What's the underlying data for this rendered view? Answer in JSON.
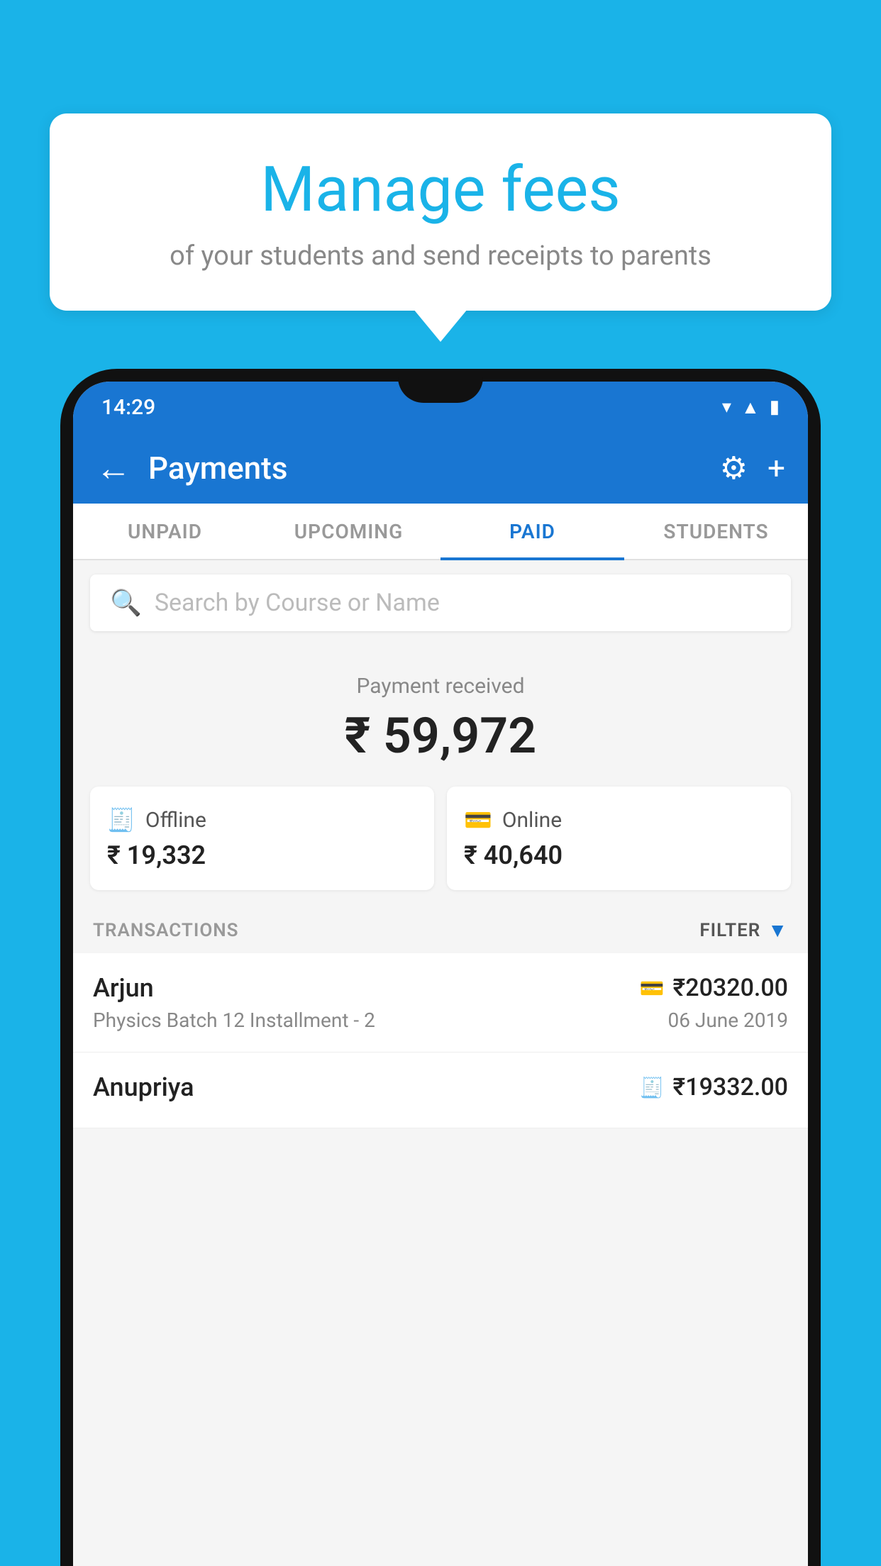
{
  "background_color": "#1ab3e8",
  "speech_bubble": {
    "title": "Manage fees",
    "subtitle": "of your students and send receipts to parents"
  },
  "status_bar": {
    "time": "14:29",
    "icons": [
      "wifi",
      "signal",
      "battery"
    ]
  },
  "header": {
    "title": "Payments",
    "back_label": "←",
    "settings_label": "⚙",
    "add_label": "+"
  },
  "tabs": [
    {
      "id": "unpaid",
      "label": "UNPAID",
      "active": false
    },
    {
      "id": "upcoming",
      "label": "UPCOMING",
      "active": false
    },
    {
      "id": "paid",
      "label": "PAID",
      "active": true
    },
    {
      "id": "students",
      "label": "STUDENTS",
      "active": false
    }
  ],
  "search": {
    "placeholder": "Search by Course or Name"
  },
  "payment_summary": {
    "label": "Payment received",
    "amount": "₹ 59,972"
  },
  "payment_cards": [
    {
      "id": "offline",
      "icon": "🧾",
      "label": "Offline",
      "amount": "₹ 19,332"
    },
    {
      "id": "online",
      "icon": "💳",
      "label": "Online",
      "amount": "₹ 40,640"
    }
  ],
  "transactions_section": {
    "label": "TRANSACTIONS",
    "filter_label": "FILTER"
  },
  "transactions": [
    {
      "student_name": "Arjun",
      "pay_type_icon": "💳",
      "amount": "₹20320.00",
      "course": "Physics Batch 12 Installment - 2",
      "date": "06 June 2019"
    },
    {
      "student_name": "Anupriya",
      "pay_type_icon": "🧾",
      "amount": "₹19332.00",
      "course": "",
      "date": ""
    }
  ]
}
